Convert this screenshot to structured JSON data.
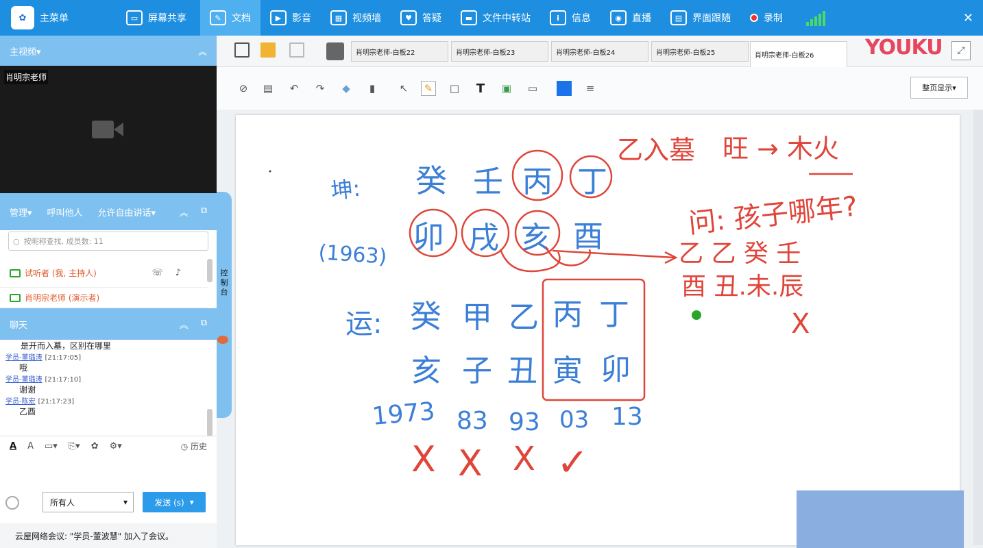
{
  "topbar": {
    "menu_label": "主菜单",
    "items": [
      {
        "label": "屏幕共享",
        "icon": "screen-share-icon"
      },
      {
        "label": "文档",
        "icon": "document-icon"
      },
      {
        "label": "影音",
        "icon": "media-play-icon"
      },
      {
        "label": "视频墙",
        "icon": "video-wall-icon"
      },
      {
        "label": "答疑",
        "icon": "qa-icon"
      },
      {
        "label": "文件中转站",
        "icon": "folder-icon"
      },
      {
        "label": "信息",
        "icon": "info-icon"
      },
      {
        "label": "直播",
        "icon": "live-icon"
      },
      {
        "label": "界面跟随",
        "icon": "layout-follow-icon"
      },
      {
        "label": "录制",
        "icon": "record-icon"
      }
    ],
    "active_index": 1,
    "close_glyph": "✕"
  },
  "left_panel": {
    "video_header": "主视频▾",
    "video_name": "肖明宗老师",
    "manage_label": "管理▾",
    "call_label": "呼叫他人",
    "free_talk_label": "允许自由讲话▾",
    "search_placeholder": "按昵称查找, 成员数: 11",
    "members": [
      {
        "name": "试听者 (我, 主持人)"
      },
      {
        "name": "肖明宗老师 (演示者)"
      }
    ],
    "chat_header": "聊天",
    "chat_messages": [
      {
        "user": "",
        "time": "",
        "text": "是开而入墓，区别在哪里"
      },
      {
        "user": "学员-董璐涛",
        "time": "[21:17:05]",
        "text": "哦"
      },
      {
        "user": "学员-董璐涛",
        "time": "[21:17:10]",
        "text": "谢谢"
      },
      {
        "user": "学员-陈宏",
        "time": "[21:17:23]",
        "text": "乙酉"
      }
    ],
    "history_label": "历史",
    "recipient": "所有人",
    "send_label": "发送 (s)",
    "notice": "云屋网络会议: \"学员-董波慧\" 加入了会议。",
    "control_label": "控制台"
  },
  "tabs": {
    "items": [
      "肖明宗老师-白板22",
      "肖明宗老师-白板23",
      "肖明宗老师-白板24",
      "肖明宗老师-白板25",
      "肖明宗老师-白板26"
    ],
    "active_index": 4,
    "brand": "YOUKU"
  },
  "toolbar": {
    "page_view_label": "整页显示▾",
    "text_tool": "T",
    "color_swatch": "#1a73e8"
  },
  "whiteboard": {
    "blue_chars_row1": [
      "癸",
      "壬",
      "丙",
      "丁"
    ],
    "blue_chars_row2": [
      "卯",
      "戌",
      "亥",
      "酉"
    ],
    "label_kun": "坤:",
    "label_year": "(1963)",
    "label_yun": "运:",
    "yun_stems": [
      "癸",
      "甲",
      "乙",
      "丙",
      "丁"
    ],
    "yun_branches": [
      "亥",
      "子",
      "丑",
      "寅",
      "卯"
    ],
    "years": [
      "1973",
      "83",
      "93",
      "03",
      "13"
    ],
    "marks": [
      "X",
      "X",
      "X",
      "✓"
    ],
    "red_note_top": "乙入墓",
    "red_note_top2": "旺 → 木火",
    "question": "问: 孩子哪年?",
    "answer_row1": "乙 乙 癸 壬",
    "answer_row2": "酉 丑.未.辰",
    "answer_x": "X"
  }
}
